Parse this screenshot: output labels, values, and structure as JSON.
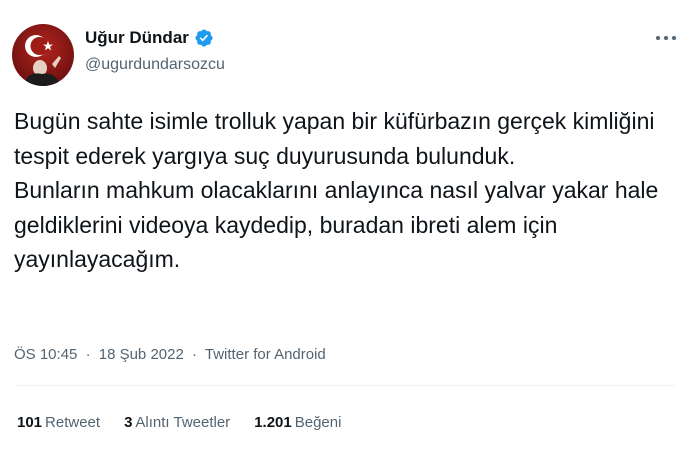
{
  "author": {
    "name": "Uğur Dündar",
    "handle": "@ugurdundarsozcu",
    "verified": true
  },
  "tweet": {
    "text_lines": [
      "Bugün sahte isimle trolluk yapan bir küfürbazın gerçek kimliğini tespit ederek yargıya suç duyurusunda bulunduk.",
      "Bunların mahkum olacaklarını anlayınca nasıl yalvar yakar hale geldiklerini videoya kaydedip, buradan ibreti alem için yayınlayacağım."
    ],
    "time": "ÖS 10:45",
    "date": "18 Şub 2022",
    "source": "Twitter for Android",
    "separator": "·"
  },
  "stats": {
    "retweets_count": "101",
    "retweets_label": "Retweet",
    "quotes_count": "3",
    "quotes_label": "Alıntı Tweetler",
    "likes_count": "1.201",
    "likes_label": "Beğeni"
  },
  "colors": {
    "verified_blue": "#1d9bf0",
    "avatar_bg": "#8b1a1a",
    "secondary_text": "#536471"
  },
  "icons": {
    "verified": "verified-badge-icon",
    "more": "more-options-icon"
  }
}
